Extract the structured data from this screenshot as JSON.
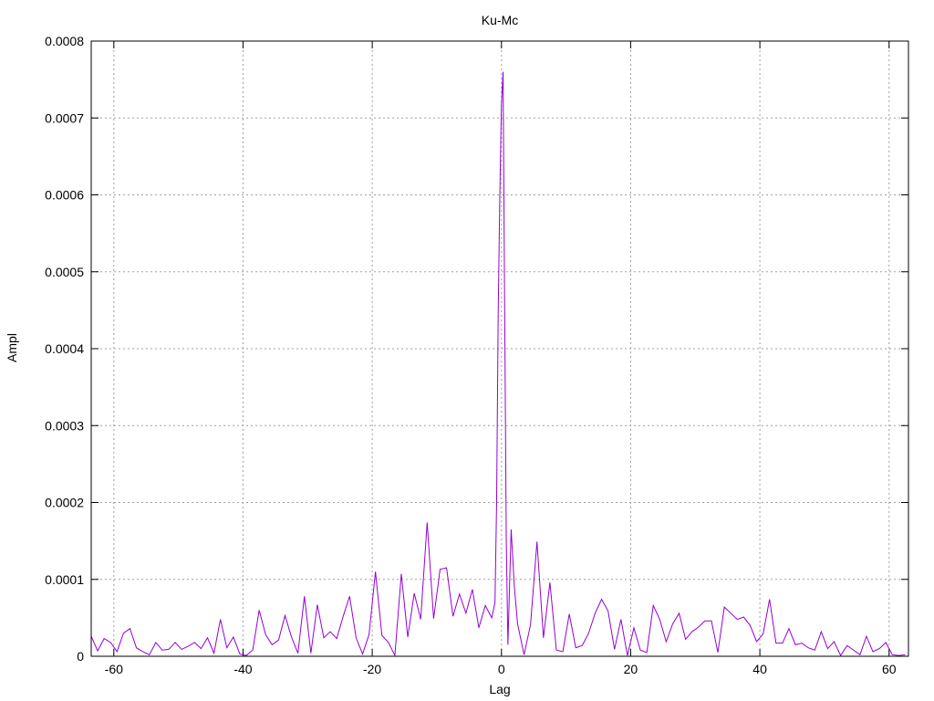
{
  "chart_data": {
    "type": "line",
    "title": "Ku-Mc",
    "xlabel": "Lag",
    "ylabel": "Ampl",
    "xlim": [
      -63.5,
      63
    ],
    "ylim": [
      0,
      0.0008
    ],
    "xticks": [
      -60,
      -40,
      -20,
      0,
      20,
      40,
      60
    ],
    "yticks": [
      0,
      0.0001,
      0.0002,
      0.0003,
      0.0004,
      0.0005,
      0.0006,
      0.0007,
      0.0008
    ],
    "ytick_labels": [
      "0",
      "0.0001",
      "0.0002",
      "0.0003",
      "0.0004",
      "0.0005",
      "0.0006",
      "0.0007",
      "0.0008"
    ],
    "grid": true,
    "line_color": "#9400d3",
    "series": [
      {
        "x": [
          -63.5,
          -62.5,
          -61.5,
          -60.5,
          -59.5,
          -58.5,
          -57.5,
          -56.5,
          -55.5,
          -54.5,
          -53.5,
          -52.5,
          -51.5,
          -50.5,
          -49.5,
          -48.5,
          -47.5,
          -46.5,
          -45.5,
          -44.5,
          -43.5,
          -42.5,
          -41.5,
          -40.5,
          -39.5,
          -38.5,
          -37.5,
          -36.5,
          -35.5,
          -34.5,
          -33.5,
          -32.5,
          -31.5,
          -30.5,
          -29.5,
          -28.5,
          -27.5,
          -26.5,
          -25.5,
          -24.5,
          -23.5,
          -22.5,
          -21.5,
          -20.5,
          -19.5,
          -18.5,
          -17.5,
          -16.5,
          -15.5,
          -14.5,
          -13.5,
          -12.5,
          -11.5,
          -10.5,
          -9.5,
          -8.5,
          -7.5,
          -6.5,
          -5.5,
          -4.5,
          -3.5,
          -2.5,
          -1.5,
          -1.0,
          -0.75,
          -0.5,
          -0.25,
          0,
          0.25,
          0.5,
          0.75,
          1.0,
          1.5,
          2.0,
          2.5,
          3.5,
          4.5,
          5.5,
          6.5,
          7.5,
          8.5,
          9.5,
          10.5,
          11.5,
          12.5,
          13.5,
          14.5,
          15.5,
          16.5,
          17.5,
          18.5,
          19.5,
          20.5,
          21.5,
          22.5,
          23.5,
          24.5,
          25.5,
          26.5,
          27.5,
          28.5,
          29.5,
          30.5,
          31.5,
          32.5,
          33.5,
          34.5,
          35.5,
          36.5,
          37.5,
          38.5,
          39.5,
          40.5,
          41.5,
          42.5,
          43.5,
          44.5,
          45.5,
          46.5,
          47.5,
          48.5,
          49.5,
          50.5,
          51.5,
          52.5,
          53.5,
          54.5,
          55.5,
          56.5,
          57.5,
          58.5,
          59.5,
          60.5,
          61.5,
          62.5
        ],
        "y": [
          2.6e-05,
          7e-06,
          2.3e-05,
          1.8e-05,
          6e-06,
          3e-05,
          3.6e-05,
          1.1e-05,
          6e-06,
          2e-06,
          1.8e-05,
          8e-06,
          9e-06,
          1.8e-05,
          9e-06,
          1.3e-05,
          1.8e-05,
          1e-05,
          2.4e-05,
          4e-06,
          4.8e-05,
          1.1e-05,
          2.5e-05,
          3e-06,
          1e-06,
          8e-06,
          6e-05,
          2.8e-05,
          1.5e-05,
          2.1e-05,
          5.3e-05,
          2.5e-05,
          4e-06,
          7.8e-05,
          4e-06,
          6.7e-05,
          2.4e-05,
          3.2e-05,
          2.3e-05,
          5.2e-05,
          7.8e-05,
          2.4e-05,
          3e-06,
          2.8e-05,
          0.00011,
          2.7e-05,
          1.8e-05,
          1e-06,
          0.000107,
          2.5e-05,
          8.2e-05,
          4.8e-05,
          0.000174,
          4.9e-05,
          0.000113,
          0.000115,
          5.2e-05,
          8.1e-05,
          5.6e-05,
          8.7e-05,
          3.7e-05,
          6.6e-05,
          5e-05,
          7e-05,
          0.0002,
          0.00045,
          0.0006,
          0.000718,
          0.00076,
          0.00045,
          0.00015,
          1.5e-05,
          0.000165,
          9e-05,
          4.2e-05,
          2e-06,
          4.1e-05,
          0.000149,
          2.4e-05,
          9.6e-05,
          8e-06,
          6e-06,
          5.5e-05,
          1.1e-05,
          1.4e-05,
          3e-05,
          5.6e-05,
          7.4e-05,
          5.9e-05,
          9e-06,
          4.8e-05,
          1e-06,
          3.7e-05,
          8e-06,
          5e-06,
          6.6e-05,
          4.8e-05,
          1.9e-05,
          4.2e-05,
          5.6e-05,
          2.2e-05,
          3.2e-05,
          3.8e-05,
          4.6e-05,
          4.6e-05,
          5e-06,
          6.4e-05,
          5.6e-05,
          4.8e-05,
          5.1e-05,
          4e-05,
          1.9e-05,
          2.9e-05,
          7.4e-05,
          1.7e-05,
          1.7e-05,
          3.6e-05,
          1.5e-05,
          1.7e-05,
          1.1e-05,
          8e-06,
          3.2e-05,
          1e-05,
          1.9e-05,
          1e-06,
          1.4e-05,
          8e-06,
          2e-06,
          2.6e-05,
          6e-06,
          1e-05,
          1.8e-05,
          2e-06,
          1e-06,
          2e-06
        ]
      }
    ]
  }
}
